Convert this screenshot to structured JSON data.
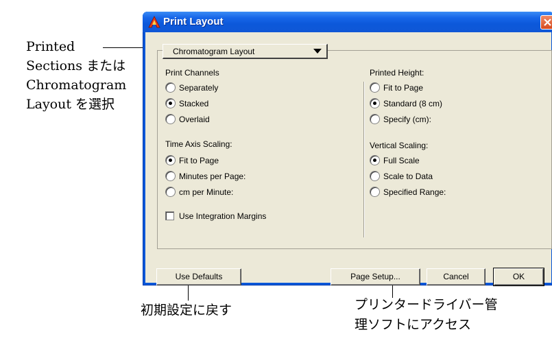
{
  "window": {
    "title": "Print Layout",
    "close_symbol": "close-icon"
  },
  "layout_select": {
    "value": "Chromatogram Layout"
  },
  "print_channels": {
    "heading": "Print Channels",
    "options": [
      "Separately",
      "Stacked",
      "Overlaid"
    ],
    "selected": "Stacked"
  },
  "time_axis": {
    "heading": "Time Axis Scaling:",
    "options": [
      "Fit to Page",
      "Minutes per Page:",
      "cm per Minute:"
    ],
    "selected": "Fit to Page"
  },
  "use_margins": {
    "label": "Use Integration Margins",
    "checked": false
  },
  "printed_height": {
    "heading": "Printed Height:",
    "options": [
      "Fit to Page",
      "Standard (8 cm)",
      "Specify (cm):"
    ],
    "selected": "Standard (8 cm)"
  },
  "vertical_scaling": {
    "heading": "Vertical Scaling:",
    "options": [
      "Full Scale",
      "Scale to Data",
      "Specified Range:"
    ],
    "selected": "Full Scale"
  },
  "buttons": {
    "use_defaults": "Use Defaults",
    "page_setup": "Page Setup...",
    "cancel": "Cancel",
    "ok": "OK"
  },
  "annotations": {
    "layout_note": [
      "Printed",
      "Sections または",
      "Chromatogram",
      "Layout を選択"
    ],
    "defaults_note": "初期設定に戻す",
    "page_setup_note": [
      "プリンタードライバー管",
      "理ソフトにアクセス"
    ]
  }
}
